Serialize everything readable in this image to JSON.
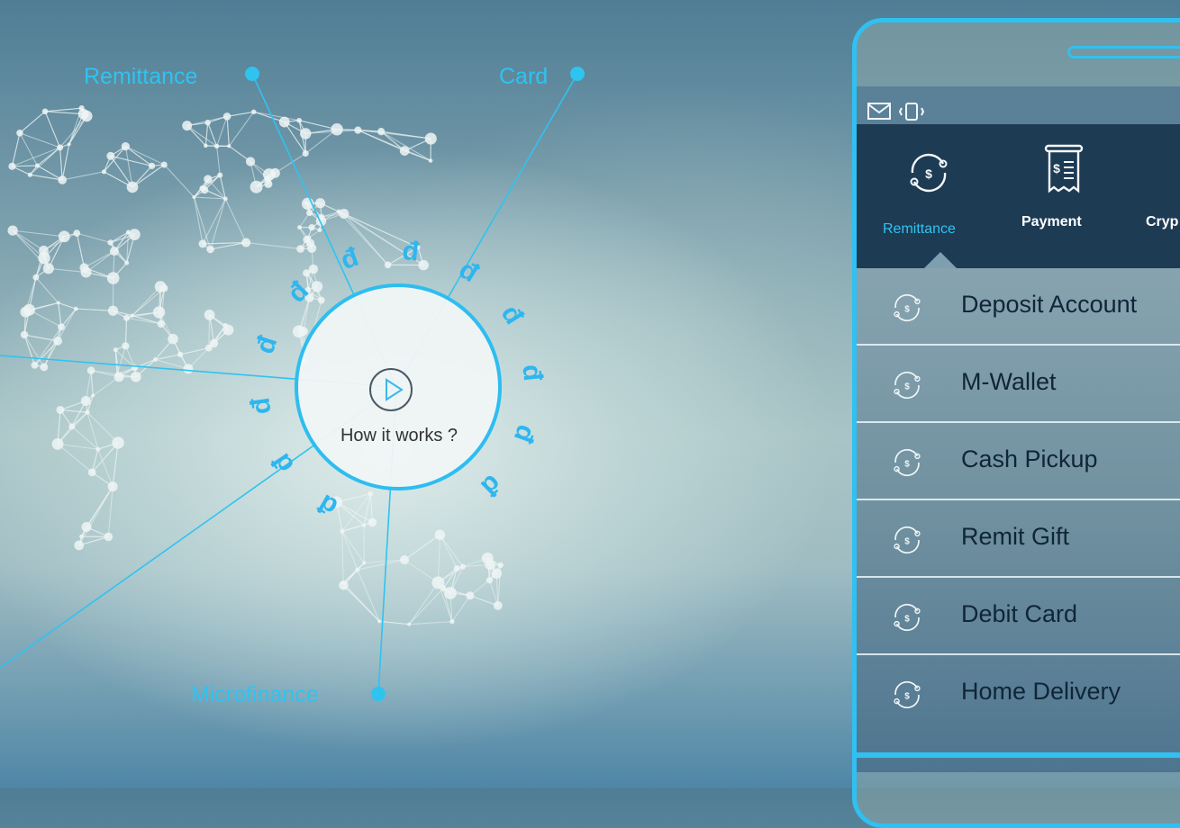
{
  "diagram": {
    "nodes": {
      "remittance": "Remittance",
      "card": "Card",
      "microfinance": "Microfinance"
    },
    "center_label": "How it works ?",
    "accent_color": "#2fc3f0"
  },
  "phone": {
    "status_icons": [
      "mail-icon",
      "vibrate-icon"
    ],
    "tabs": [
      {
        "label": "Remittance",
        "icon": "remittance-icon",
        "active": true
      },
      {
        "label": "Payment",
        "icon": "receipt-icon",
        "active": false
      },
      {
        "label": "Cryp",
        "icon": "crypto-icon",
        "active": false
      }
    ],
    "menu_items": [
      {
        "label": "Deposit Account",
        "icon": "remittance-icon"
      },
      {
        "label": "M-Wallet",
        "icon": "remittance-icon"
      },
      {
        "label": "Cash Pickup",
        "icon": "remittance-icon"
      },
      {
        "label": "Remit Gift",
        "icon": "remittance-icon"
      },
      {
        "label": "Debit Card",
        "icon": "remittance-icon"
      },
      {
        "label": "Home Delivery",
        "icon": "remittance-icon"
      }
    ],
    "colors": {
      "frame": "#30c0f2",
      "tabs_bg": "#1e3b54",
      "active_tab": "#2fc3f0",
      "inactive_tab": "#ffffff"
    }
  }
}
